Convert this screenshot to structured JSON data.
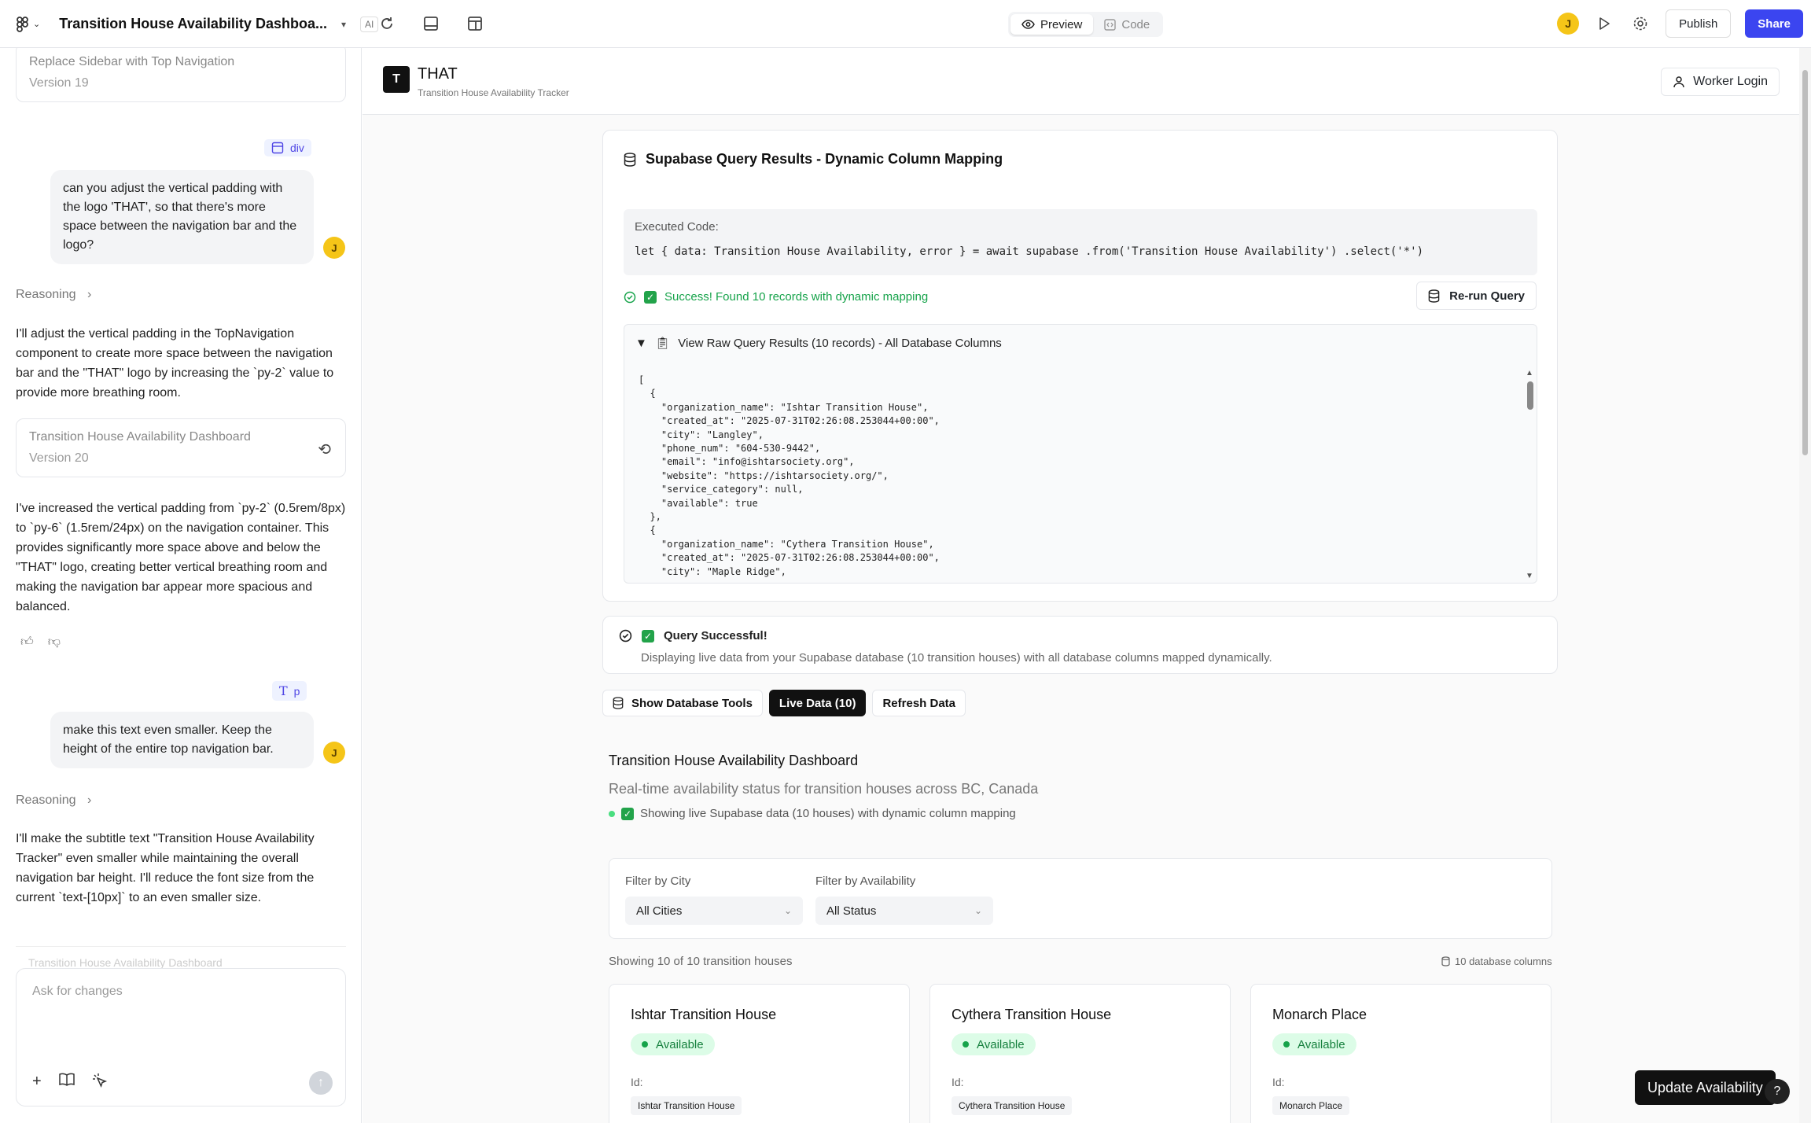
{
  "topbar": {
    "project_title": "Transition House Availability Dashboa...",
    "ai_badge": "AI",
    "tabs": [
      {
        "label": "Preview",
        "active": true
      },
      {
        "label": "Code",
        "active": false
      }
    ],
    "user_initial": "J",
    "publish_label": "Publish",
    "share_label": "Share",
    "colors": {
      "share_bg": "#3b45f0",
      "avatar": "#f5c518"
    }
  },
  "chat": {
    "version_19": {
      "title": "Replace Sidebar with Top Navigation",
      "version": "Version 19"
    },
    "tag_1": "div",
    "msg_1": "can you adjust the vertical padding with the logo 'THAT', so that there's more space between the navigation bar and the logo?",
    "reasoning_label": "Reasoning",
    "resp_1": "I'll adjust the vertical padding in the TopNavigation component to create more space between the navigation bar and the \"THAT\" logo by increasing the `py-2` value to provide more breathing room.",
    "version_20": {
      "title": "Transition House Availability Dashboard",
      "version": "Version 20"
    },
    "resp_2": "I've increased the vertical padding from `py-2` (0.5rem/8px) to `py-6` (1.5rem/24px) on the navigation container. This provides significantly more space above and below the \"THAT\" logo, creating better vertical breathing room and making the navigation bar appear more spacious and balanced.",
    "tag_2": "p",
    "msg_2": "make this text even smaller. Keep the height of the entire top navigation bar.",
    "resp_3": "I'll make the subtitle text \"Transition House Availability Tracker\" even smaller while maintaining the overall navigation bar height. I'll reduce the font size from the current `text-[10px]` to an even smaller size.",
    "faded_card": "Transition House Availability Dashboard",
    "composer_placeholder": "Ask for changes",
    "user_initial": "J"
  },
  "app": {
    "logo_letter": "T",
    "title": "THAT",
    "subtitle": "Transition House Availability Tracker",
    "worker_login": "Worker Login"
  },
  "query": {
    "title": "Supabase Query Results - Dynamic Column Mapping",
    "executed_label": "Executed Code:",
    "code": "let { data: Transition House Availability, error } = await supabase .from('Transition House Availability') .select('*')",
    "success": "Success! Found 10 records with dynamic mapping",
    "rerun": "Re-run Query",
    "raw_summary": "View Raw Query Results (10 records) - All Database Columns",
    "raw_json": "[\n  {\n    \"organization_name\": \"Ishtar Transition House\",\n    \"created_at\": \"2025-07-31T02:26:08.253044+00:00\",\n    \"city\": \"Langley\",\n    \"phone_num\": \"604-530-9442\",\n    \"email\": \"info@ishtarsociety.org\",\n    \"website\": \"https://ishtarsociety.org/\",\n    \"service_category\": null,\n    \"available\": true\n  },\n  {\n    \"organization_name\": \"Cythera Transition House\",\n    \"created_at\": \"2025-07-31T02:26:08.253044+00:00\",\n    \"city\": \"Maple Ridge\","
  },
  "status": {
    "title": "Query Successful!",
    "desc": "Displaying live data from your Supabase database (10 transition houses) with all database columns mapped dynamically."
  },
  "buttons": {
    "show_tools": "Show Database Tools",
    "live_data": "Live Data (10)",
    "refresh": "Refresh Data"
  },
  "dashboard": {
    "title": "Transition House Availability Dashboard",
    "subtitle": "Real-time availability status for transition houses across BC, Canada",
    "live": "Showing live Supabase data (10 houses) with dynamic column mapping",
    "filter_city_label": "Filter by City",
    "filter_city_value": "All Cities",
    "filter_avail_label": "Filter by Availability",
    "filter_avail_value": "All Status",
    "showing": "Showing 10 of 10 transition houses",
    "db_columns": "10 database columns",
    "houses": [
      {
        "name": "Ishtar Transition House",
        "status": "Available",
        "id_label": "Id:",
        "id": "Ishtar Transition House"
      },
      {
        "name": "Cythera Transition House",
        "status": "Available",
        "id_label": "Id:",
        "id": "Cythera Transition House"
      },
      {
        "name": "Monarch Place",
        "status": "Available",
        "id_label": "Id:",
        "id": "Monarch Place"
      }
    ],
    "update_btn": "Update Availability",
    "help": "?"
  }
}
